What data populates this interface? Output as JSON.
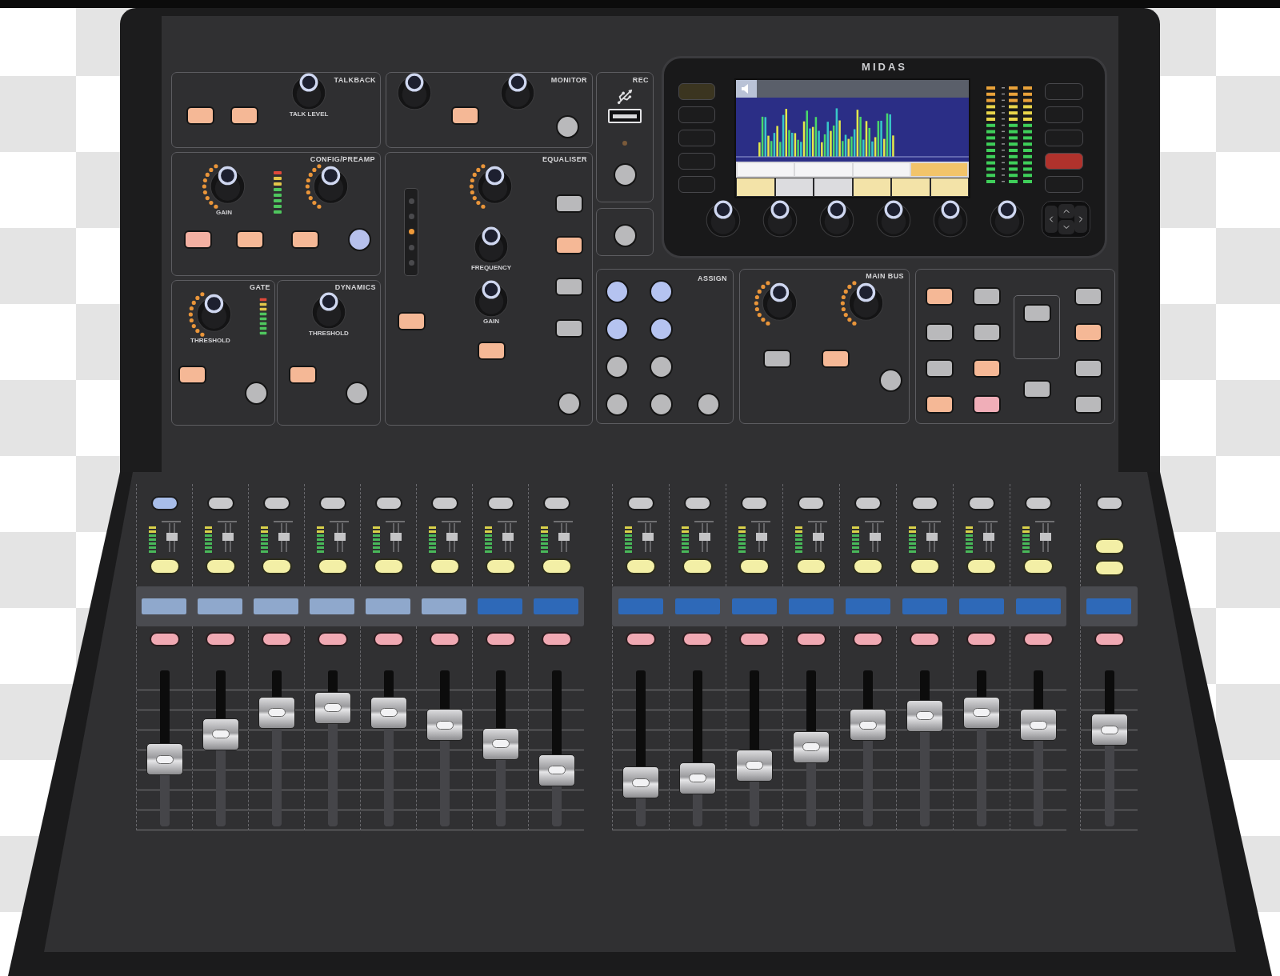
{
  "talkback": {
    "title": "TALKBACK",
    "buttons": [
      {
        "kind": "rect",
        "color": "#f5b896"
      },
      {
        "kind": "rect",
        "color": "#f5b896"
      }
    ],
    "knob": {
      "kind": "plain",
      "label": "TALK LEVEL"
    }
  },
  "monitor": {
    "title": "MONITOR",
    "knobs": [
      {
        "kind": "plain"
      },
      {
        "kind": "plain"
      }
    ],
    "button": {
      "kind": "rect",
      "color": "#f5b896"
    },
    "view_button": {
      "kind": "round",
      "color": "#b9b9bb"
    }
  },
  "config_preamp": {
    "title": "CONFIG/PREAMP",
    "knobs": [
      {
        "kind": "led",
        "label": "GAIN"
      },
      {
        "kind": "led"
      }
    ],
    "buttons": [
      {
        "kind": "rect",
        "color": "#f3b0a2"
      },
      {
        "kind": "rect",
        "color": "#f5b896"
      },
      {
        "kind": "rect",
        "color": "#f5b896"
      },
      {
        "kind": "round",
        "color": "#b6c0ec"
      }
    ]
  },
  "equaliser": {
    "title": "EQUALISER",
    "band_leds": [
      {
        "on": false
      },
      {
        "on": false
      },
      {
        "on": true
      },
      {
        "on": false
      },
      {
        "on": false
      }
    ],
    "knobs": [
      {
        "kind": "led"
      },
      {
        "kind": "plain",
        "label": "FREQUENCY"
      },
      {
        "kind": "plain",
        "label": "GAIN"
      }
    ],
    "side_buttons": [
      {
        "kind": "rect",
        "color": "#b9b9bb"
      },
      {
        "kind": "rect",
        "color": "#f5b896"
      },
      {
        "kind": "rect",
        "color": "#b9b9bb"
      },
      {
        "kind": "rect",
        "color": "#b9b9bb"
      }
    ],
    "mode_button": {
      "kind": "rect",
      "color": "#f5b896"
    },
    "eq_button": {
      "kind": "rect",
      "color": "#f5b896"
    },
    "view_button": {
      "kind": "round",
      "color": "#b9b9bb"
    }
  },
  "gate": {
    "title": "GATE",
    "knob": {
      "kind": "led",
      "label": "THRESHOLD"
    },
    "button": {
      "kind": "rect",
      "color": "#f5b896"
    },
    "view_button": {
      "kind": "round",
      "color": "#b9b9bb"
    }
  },
  "dynamics": {
    "title": "DYNAMICS",
    "knob": {
      "kind": "plain",
      "label": "THRESHOLD"
    },
    "button": {
      "kind": "rect",
      "color": "#f5b896"
    },
    "view_button": {
      "kind": "round",
      "color": "#b9b9bb"
    }
  },
  "rec": {
    "title": "REC",
    "view_button": {
      "kind": "round",
      "color": "#b9b9bb"
    }
  },
  "mute_groups": {
    "view_button": {
      "kind": "round",
      "color": "#b9b9bb"
    }
  },
  "display": {
    "logo": "MIDAS",
    "left_buttons": [
      {
        "color": "#3b3520"
      },
      {
        "color": "#1c1c1d"
      },
      {
        "color": "#1c1c1d"
      },
      {
        "color": "#1c1c1d"
      },
      {
        "color": "#1c1c1d"
      }
    ],
    "right_buttons": [
      {
        "color": "#1c1c1d"
      },
      {
        "color": "#1c1c1d"
      },
      {
        "color": "#1c1c1d"
      },
      {
        "color": "#b0322c"
      },
      {
        "color": "#1c1c1d"
      }
    ],
    "parameter_slots": [
      {
        "selected": false
      },
      {
        "selected": false
      },
      {
        "selected": false
      },
      {
        "selected": true
      }
    ],
    "tabs": [
      {
        "lit": true
      },
      {
        "lit": false
      },
      {
        "lit": false
      },
      {
        "lit": true
      },
      {
        "lit": true
      },
      {
        "lit": true
      }
    ],
    "knobs": [
      {
        "kind": "plain"
      },
      {
        "kind": "plain"
      },
      {
        "kind": "plain"
      },
      {
        "kind": "plain"
      },
      {
        "kind": "plain"
      },
      {
        "kind": "plain"
      }
    ]
  },
  "assign": {
    "title": "ASSIGN",
    "buttons": [
      {
        "kind": "round",
        "color": "#b5c3f0"
      },
      {
        "kind": "round",
        "color": "#b5c3f0"
      },
      {
        "kind": "round",
        "color": "#b5c3f0"
      },
      {
        "kind": "round",
        "color": "#b5c3f0"
      },
      {
        "kind": "round",
        "color": "#b9b9bb"
      },
      {
        "kind": "round",
        "color": "#b9b9bb"
      },
      {
        "kind": "round",
        "color": "#b9b9bb"
      },
      {
        "kind": "round",
        "color": "#b9b9bb"
      },
      {
        "kind": "round",
        "color": "#b9b9bb"
      }
    ]
  },
  "main_bus": {
    "title": "MAIN BUS",
    "knobs": [
      {
        "kind": "led"
      },
      {
        "kind": "led"
      }
    ],
    "buttons": [
      {
        "kind": "rect",
        "color": "#b9b9bb"
      },
      {
        "kind": "rect",
        "color": "#f5b896"
      }
    ],
    "view_button": {
      "kind": "round",
      "color": "#b9b9bb"
    }
  },
  "fader_layer": {
    "columns": [
      {
        "kind": "plain",
        "buttons": [
          {
            "kind": "rect",
            "color": "#f5b896"
          },
          {
            "kind": "rect",
            "color": "#b9b9bb"
          },
          {
            "kind": "rect",
            "color": "#b9b9bb"
          },
          {
            "kind": "rect",
            "color": "#f5b896"
          }
        ]
      },
      {
        "kind": "plain",
        "buttons": [
          {
            "kind": "rect",
            "color": "#b9b9bb"
          },
          {
            "kind": "rect",
            "color": "#b9b9bb"
          },
          {
            "kind": "rect",
            "color": "#f5b896"
          },
          {
            "kind": "rect",
            "color": "#f0aeb8"
          }
        ]
      },
      {
        "kind": "grouped",
        "buttons": [
          {
            "kind": "rect",
            "color": "#b9b9bb"
          },
          {
            "kind": "rect",
            "color": "#b9b9bb"
          }
        ]
      },
      {
        "kind": "plain",
        "buttons": [
          {
            "kind": "rect",
            "color": "#b9b9bb"
          },
          {
            "kind": "rect",
            "color": "#f5b896"
          },
          {
            "kind": "rect",
            "color": "#b9b9bb"
          },
          {
            "kind": "rect",
            "color": "#b9b9bb"
          }
        ]
      }
    ]
  },
  "channels": [
    {
      "selected": true,
      "color": "#8fa8cc",
      "level": 0.43
    },
    {
      "selected": false,
      "color": "#8fa8cc",
      "level": 0.59
    },
    {
      "selected": false,
      "color": "#8fa8cc",
      "level": 0.73
    },
    {
      "selected": false,
      "color": "#8fa8cc",
      "level": 0.76
    },
    {
      "selected": false,
      "color": "#8fa8cc",
      "level": 0.73
    },
    {
      "selected": false,
      "color": "#8fa8cc",
      "level": 0.65
    },
    {
      "selected": false,
      "color": "#2e69b8",
      "level": 0.53
    },
    {
      "selected": false,
      "color": "#2e69b8",
      "level": 0.36
    },
    {
      "selected": false,
      "color": "#2e69b8",
      "level": 0.28
    },
    {
      "selected": false,
      "color": "#2e69b8",
      "level": 0.31
    },
    {
      "selected": false,
      "color": "#2e69b8",
      "level": 0.39
    },
    {
      "selected": false,
      "color": "#2e69b8",
      "level": 0.51
    },
    {
      "selected": false,
      "color": "#2e69b8",
      "level": 0.65
    },
    {
      "selected": false,
      "color": "#2e69b8",
      "level": 0.71
    },
    {
      "selected": false,
      "color": "#2e69b8",
      "level": 0.73
    },
    {
      "selected": false,
      "color": "#2e69b8",
      "level": 0.65
    }
  ],
  "master": {
    "kind": "main",
    "selected": false,
    "color": "#2e69b8",
    "level": 0.62
  }
}
